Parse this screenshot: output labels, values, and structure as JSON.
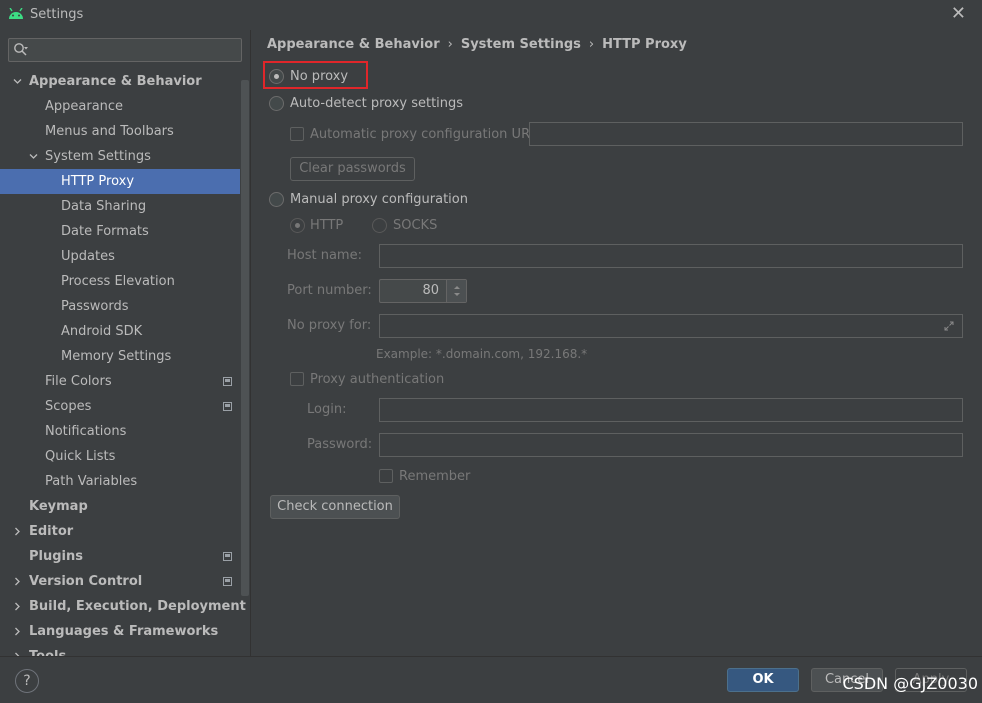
{
  "window": {
    "title": "Settings",
    "close_glyph": "✕"
  },
  "search": {
    "placeholder": "",
    "icon": "search-icon"
  },
  "tree": [
    {
      "label": "Appearance & Behavior",
      "level": 0,
      "bold": true,
      "expanded": true
    },
    {
      "label": "Appearance",
      "level": 1
    },
    {
      "label": "Menus and Toolbars",
      "level": 1
    },
    {
      "label": "System Settings",
      "level": 1,
      "expanded": true
    },
    {
      "label": "HTTP Proxy",
      "level": 2,
      "selected": true
    },
    {
      "label": "Data Sharing",
      "level": 2
    },
    {
      "label": "Date Formats",
      "level": 2
    },
    {
      "label": "Updates",
      "level": 2
    },
    {
      "label": "Process Elevation",
      "level": 2
    },
    {
      "label": "Passwords",
      "level": 2
    },
    {
      "label": "Android SDK",
      "level": 2
    },
    {
      "label": "Memory Settings",
      "level": 2
    },
    {
      "label": "File Colors",
      "level": 1,
      "project": true
    },
    {
      "label": "Scopes",
      "level": 1,
      "project": true
    },
    {
      "label": "Notifications",
      "level": 1
    },
    {
      "label": "Quick Lists",
      "level": 1
    },
    {
      "label": "Path Variables",
      "level": 1
    },
    {
      "label": "Keymap",
      "level": 0,
      "bold": true
    },
    {
      "label": "Editor",
      "level": 0,
      "bold": true,
      "collapsed": true
    },
    {
      "label": "Plugins",
      "level": 0,
      "bold": true,
      "project": true
    },
    {
      "label": "Version Control",
      "level": 0,
      "bold": true,
      "collapsed": true,
      "project": true
    },
    {
      "label": "Build, Execution, Deployment",
      "level": 0,
      "bold": true,
      "collapsed": true
    },
    {
      "label": "Languages & Frameworks",
      "level": 0,
      "bold": true,
      "collapsed": true
    },
    {
      "label": "Tools",
      "level": 0,
      "bold": true,
      "collapsed": true
    }
  ],
  "breadcrumb": {
    "items": [
      "Appearance & Behavior",
      "System Settings",
      "HTTP Proxy"
    ],
    "separator": "›"
  },
  "proxy": {
    "no_proxy": "No proxy",
    "auto_detect": "Auto-detect proxy settings",
    "auto_config_url": "Automatic proxy configuration URL:",
    "clear_passwords": "Clear passwords",
    "manual": "Manual proxy configuration",
    "http": "HTTP",
    "socks": "SOCKS",
    "host_label": "Host name:",
    "port_label": "Port number:",
    "port_value": "80",
    "no_proxy_for_label": "No proxy for:",
    "example": "Example: *.domain.com, 192.168.*",
    "proxy_auth": "Proxy authentication",
    "login_label": "Login:",
    "password_label": "Password:",
    "remember": "Remember",
    "check_connection": "Check connection"
  },
  "footer": {
    "help": "?",
    "ok": "OK",
    "cancel": "Cancel",
    "apply": "Apply"
  },
  "watermark": "CSDN @GJZ0030",
  "colors": {
    "background": "#3c3f41",
    "selection": "#4b6eaf",
    "ok_button": "#365880",
    "highlight_box": "#e0262a"
  }
}
